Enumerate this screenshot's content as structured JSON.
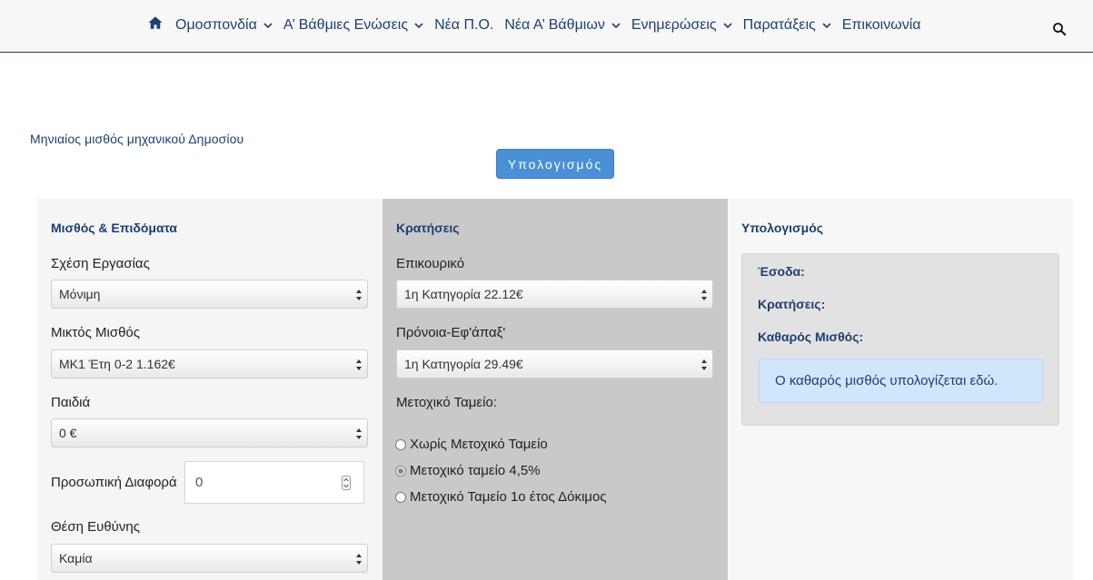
{
  "nav": {
    "items": [
      {
        "label": "Ομοσπονδία",
        "dropdown": true
      },
      {
        "label": "Α’ Βάθμιες Ενώσεις",
        "dropdown": true
      },
      {
        "label": "Νέα Π.Ο.",
        "dropdown": false
      },
      {
        "label": "Νέα Α’ Βάθμιων",
        "dropdown": true
      },
      {
        "label": "Ενημερώσεις",
        "dropdown": true
      },
      {
        "label": "Παρατάξεις",
        "dropdown": true
      },
      {
        "label": "Επικοινωνία",
        "dropdown": false
      }
    ],
    "icons": {
      "home": "home-icon",
      "search": "search-icon"
    }
  },
  "page": {
    "link_text": "Μηνιαίος μισθός μηχανικού Δημοσίου",
    "calculate_button": "Υπολογισμός"
  },
  "left": {
    "title": "Μισθός & Επιδόματα",
    "employment_label": "Σχέση Εργασίας",
    "employment_value": "Μόνιμη",
    "salary_label": "Μικτός Μισθός",
    "salary_value": "ΜΚ1 Έτη 0-2 1.162€",
    "children_label": "Παιδιά",
    "children_value": "0 €",
    "personal_diff_label": "Προσωπική Διαφορά",
    "personal_diff_value": "0",
    "position_label": "Θέση Ευθύνης",
    "position_value": "Καμία"
  },
  "middle": {
    "title": "Κρατήσεις",
    "aux_label": "Επικουρικό",
    "aux_value": "1η Κατηγορία 22.12€",
    "pronoia_label": "Πρόνοια-Εφ'άπαξ'",
    "pronoia_value": "1η Κατηγορία 29.49€",
    "fund_label": "Μετοχικό Ταμείο:",
    "fund_options": [
      {
        "label": "Χωρίς Μετοχικό Ταμείο",
        "checked": false
      },
      {
        "label": "Μετοχικό ταμείο 4,5%",
        "checked": true
      },
      {
        "label": "Μετοχικό Ταμείο 1ο έτος Δόκιμος",
        "checked": false
      }
    ]
  },
  "right": {
    "title": "Υπολογισμός",
    "income_label": "Έσοδα:",
    "deductions_label": "Κρατήσεις:",
    "net_label": "Καθαρός Μισθός:",
    "info_text": "Ο καθαρός μισθός υπολογίζεται εδώ."
  },
  "colors": {
    "brand": "#1e3f74",
    "button": "#4a90d6",
    "middle_column": "#c9c9c9",
    "info_bg": "#cfe6fb"
  }
}
